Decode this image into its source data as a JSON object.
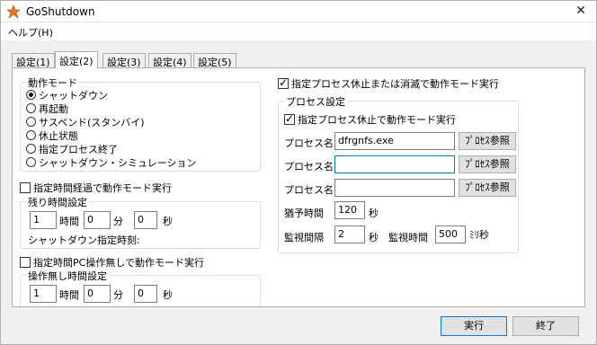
{
  "window": {
    "title": "GoShutdown",
    "close_glyph": "✕",
    "icon": "app-icon"
  },
  "menu": {
    "help_label": "ヘルプ(H)"
  },
  "tabs": [
    {
      "label": "設定(1)"
    },
    {
      "label": "設定(2)"
    },
    {
      "label": "設定(3)"
    },
    {
      "label": "設定(4)"
    },
    {
      "label": "設定(5)"
    }
  ],
  "active_tab": 1,
  "action_mode": {
    "label": "動作モード",
    "options": [
      {
        "label": "シャットダウン",
        "selected": true
      },
      {
        "label": "再起動",
        "selected": false
      },
      {
        "label": "サスペンド(スタンバイ)",
        "selected": false
      },
      {
        "label": "休止状態",
        "selected": false
      },
      {
        "label": "指定プロセス終了",
        "selected": false
      },
      {
        "label": "シャットダウン・シミュレーション",
        "selected": false
      }
    ]
  },
  "elapsed": {
    "check_label": "指定時間経過で動作モード実行",
    "checked": false,
    "group_label": "残り時間設定",
    "hours": "1",
    "hours_unit": "時間",
    "minutes": "0",
    "minutes_unit": "分",
    "seconds": "0",
    "seconds_unit": "秒",
    "shutdown_time_label": "シャットダウン指定時刻:"
  },
  "idle": {
    "check_label": "指定時間PC操作無しで動作モード実行",
    "checked": false,
    "group_label": "操作無し時間設定",
    "hours": "1",
    "hours_unit": "時間",
    "minutes": "0",
    "minutes_unit": "分",
    "seconds": "0",
    "seconds_unit": "秒"
  },
  "process": {
    "check_label": "指定プロセス休止または消滅で動作モード実行",
    "checked": true,
    "group_label": "プロセス設定",
    "inner_check_label": "指定プロセス休止で動作モード実行",
    "inner_checked": true,
    "rows": [
      {
        "label": "プロセス名",
        "value": "dfrgnfs.exe",
        "button": "ﾌﾟﾛｾｽ参照"
      },
      {
        "label": "プロセス名",
        "value": "",
        "button": "ﾌﾟﾛｾｽ参照"
      },
      {
        "label": "プロセス名",
        "value": "",
        "button": "ﾌﾟﾛｾｽ参照"
      }
    ],
    "grace_label": "猶予時間",
    "grace_value": "120",
    "grace_unit": "秒",
    "interval_label": "監視間隔",
    "interval_value": "2",
    "interval_unit": "秒",
    "monitor_label": "監視時間",
    "monitor_value": "500",
    "monitor_unit": "ﾐﾘ秒"
  },
  "footer": {
    "run_label": "実行",
    "exit_label": "終了"
  }
}
